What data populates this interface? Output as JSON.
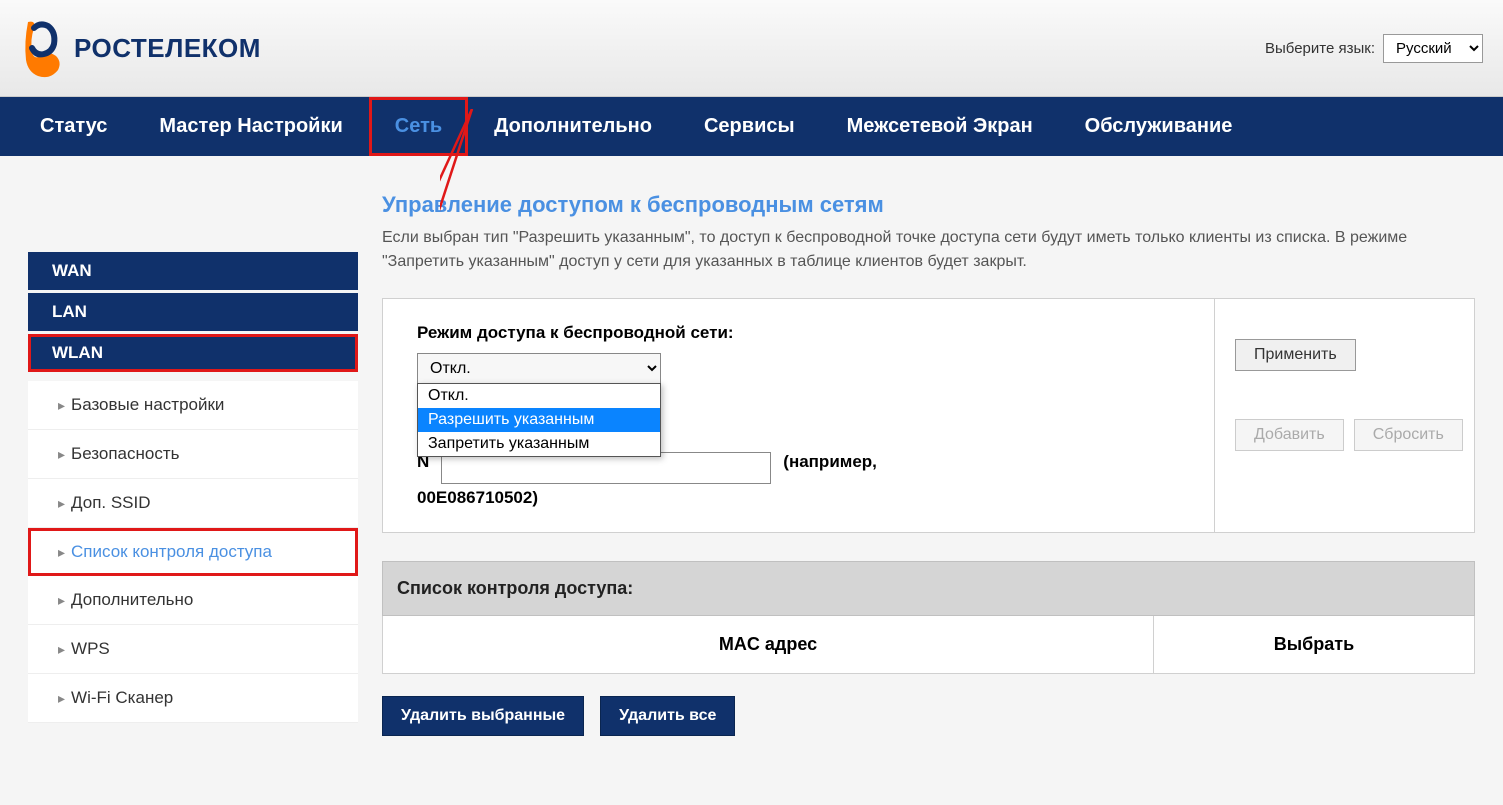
{
  "header": {
    "logo_text": "РОСТЕЛЕКОМ",
    "lang_label": "Выберите язык:",
    "lang_value": "Русский"
  },
  "nav": {
    "status": "Статус",
    "wizard": "Мастер Настройки",
    "network": "Сеть",
    "advanced": "Дополнительно",
    "services": "Сервисы",
    "firewall": "Межсетевой Экран",
    "maintenance": "Обслуживание"
  },
  "sidebar": {
    "wan": "WAN",
    "lan": "LAN",
    "wlan": "WLAN",
    "items": [
      "Базовые настройки",
      "Безопасность",
      "Доп. SSID",
      "Список контроля доступа",
      "Дополнительно",
      "WPS",
      "Wi-Fi Сканер"
    ]
  },
  "content": {
    "title": "Управление доступом к беспроводным сетям",
    "description": "Если выбран тип \"Разрешить указанным\", то доступ к беспроводной точке доступа сети будут иметь только клиенты из списка. В режиме \"Запретить указанным\" доступ у сети для указанных в таблице клиентов будет закрыт.",
    "mode_label": "Режим доступа к беспроводной сети:",
    "mode_selected": "Откл.",
    "mode_options": [
      "Откл.",
      "Разрешить указанным",
      "Запретить указанным"
    ],
    "example_label": "(например,",
    "example_value": "00E086710502)",
    "apply_btn": "Применить",
    "add_btn": "Добавить",
    "reset_btn": "Сбросить",
    "acl_title": "Список контроля доступа:",
    "col_mac": "MAC адрес",
    "col_select": "Выбрать",
    "delete_selected": "Удалить выбранные",
    "delete_all": "Удалить все"
  }
}
